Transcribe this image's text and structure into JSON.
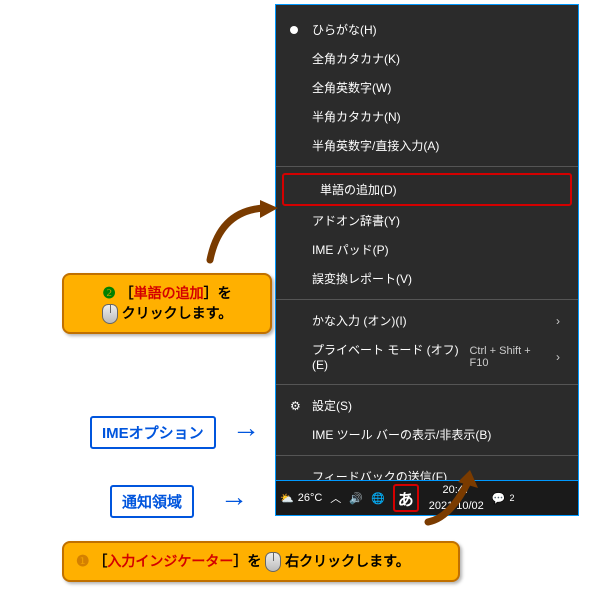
{
  "menu": {
    "items": [
      {
        "label": "ひらがな(H)",
        "selected": true
      },
      {
        "label": "全角カタカナ(K)"
      },
      {
        "label": "全角英数字(W)"
      },
      {
        "label": "半角カタカナ(N)"
      },
      {
        "label": "半角英数字/直接入力(A)"
      }
    ],
    "add_word": "単語の追加(D)",
    "addon_dict": "アドオン辞書(Y)",
    "ime_pad": "IME パッド(P)",
    "misconv": "誤変換レポート(V)",
    "kana_input": "かな入力 (オン)(I)",
    "private_mode": "プライベート モード (オフ)(E)",
    "private_shortcut": "Ctrl + Shift + F10",
    "settings": "設定(S)",
    "toolbar_toggle": "IME ツール バーの表示/非表示(B)",
    "feedback": "フィードバックの送信(F)"
  },
  "taskbar": {
    "temp": "26°C",
    "ime_char": "あ",
    "time": "20:47",
    "date": "2021/10/02",
    "notif_count": "2"
  },
  "callouts": {
    "step1_pre": "［",
    "step1_target": "入力インジケーター",
    "step1_post": "］を",
    "step1_action": "右クリック",
    "step1_suffix": "します。",
    "step2_pre": "［",
    "step2_target": "単語の追加",
    "step2_post": "］を",
    "step2_action": "クリック",
    "step2_suffix": "します。",
    "ime_option": "IMEオプション",
    "notif_area": "通知領域",
    "num1": "❶",
    "num2": "❷"
  }
}
